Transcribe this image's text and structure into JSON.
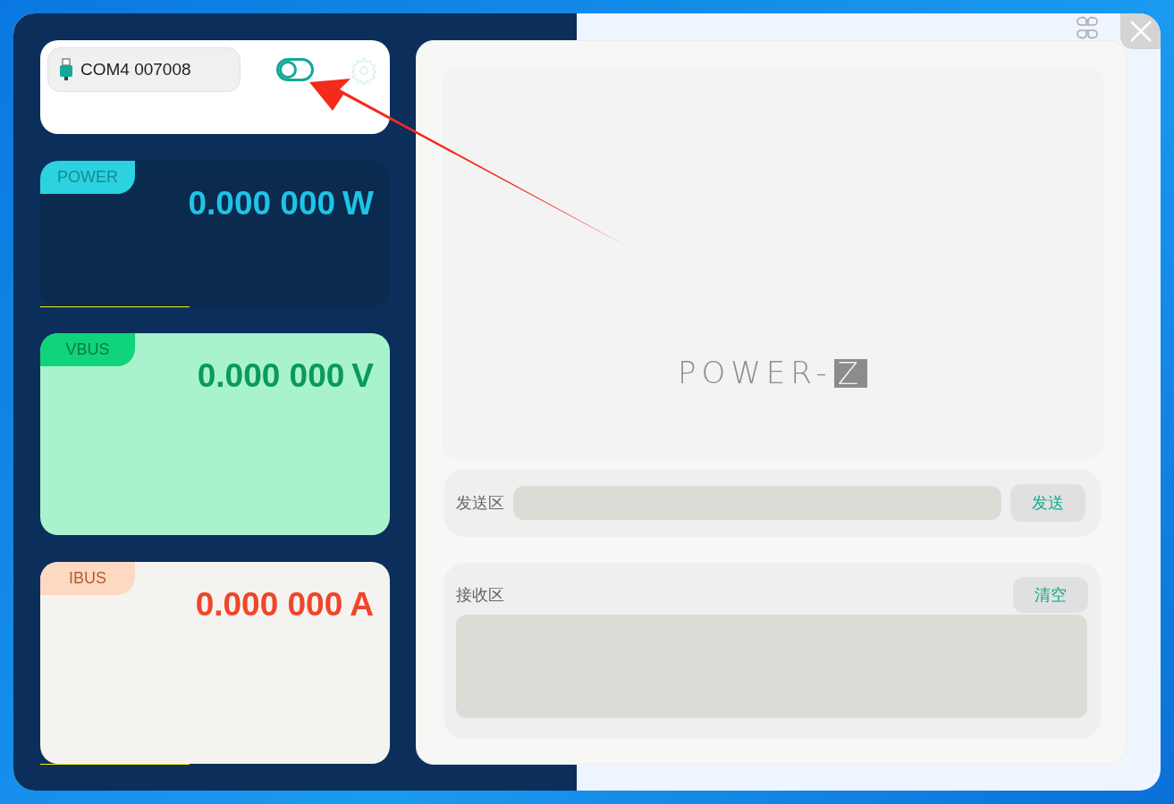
{
  "device": {
    "port": "COM4 007008",
    "connect_switch": {
      "on": false
    }
  },
  "meters": [
    {
      "kind": "power",
      "label": "POWER",
      "reading": "0.000 000",
      "unit": "W"
    },
    {
      "kind": "vbus",
      "label": "VBUS",
      "reading": "0.000 000",
      "unit": "V"
    },
    {
      "kind": "ibus",
      "label": "IBUS",
      "reading": "0.000 000",
      "unit": "A"
    }
  ],
  "display": {
    "logo_text": "POWER-",
    "logo_mark": "Z"
  },
  "send": {
    "label": "发送区",
    "button": "发送"
  },
  "receive": {
    "label": "接收区",
    "button": "清空"
  }
}
